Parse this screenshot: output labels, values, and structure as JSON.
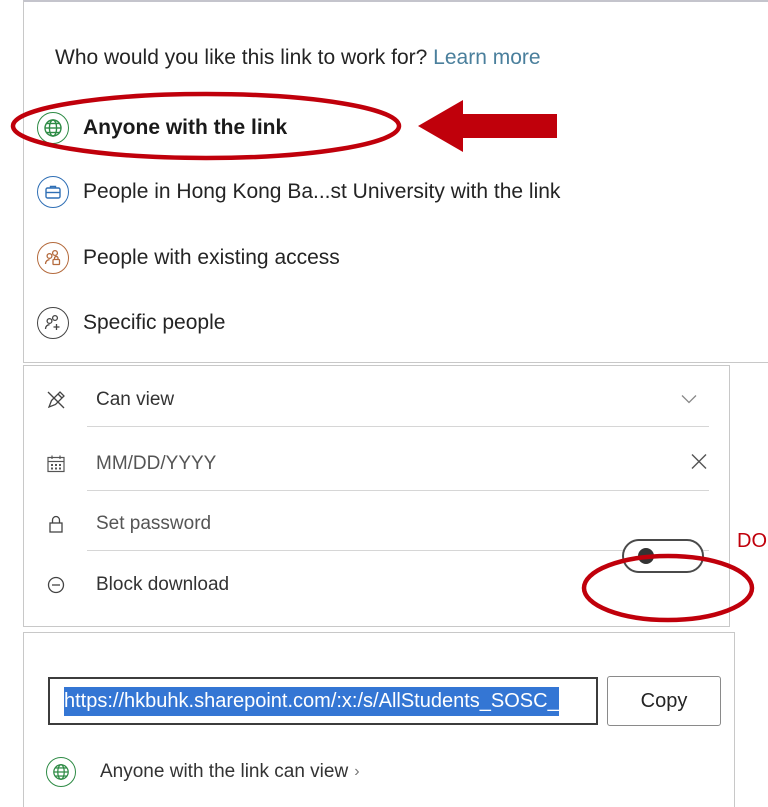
{
  "share_scope": {
    "question": "Who would you like this link to work for?",
    "learn_more": "Learn more",
    "options": [
      {
        "label": "Anyone with the link",
        "icon": "globe-icon",
        "color": "#2e8b45",
        "selected": true
      },
      {
        "label": "People in Hong Kong Ba...st University with the link",
        "icon": "briefcase-icon",
        "color": "#2f6fb5",
        "selected": false
      },
      {
        "label": "People with existing access",
        "icon": "people-lock-icon",
        "color": "#b46a3c",
        "selected": false
      },
      {
        "label": "Specific people",
        "icon": "people-add-icon",
        "color": "#444444",
        "selected": false
      }
    ]
  },
  "link_settings": {
    "permission": {
      "value": "Can view",
      "icon": "pen-icon"
    },
    "expiry": {
      "placeholder": "MM/DD/YYYY",
      "icon": "calendar-icon"
    },
    "password": {
      "placeholder": "Set password",
      "icon": "lock-icon"
    },
    "block_download": {
      "label": "Block download",
      "icon": "minus-circle-icon",
      "enabled": false
    }
  },
  "link_output": {
    "url": "https://hkbuhk.sharepoint.com/:x:/s/AllStudents_SOSC_",
    "copy_label": "Copy",
    "summary": "Anyone with the link can view",
    "summary_chevron": "›",
    "summary_icon": "globe-icon"
  },
  "annotations": {
    "side_text": "DO",
    "color": "#c0000b"
  }
}
